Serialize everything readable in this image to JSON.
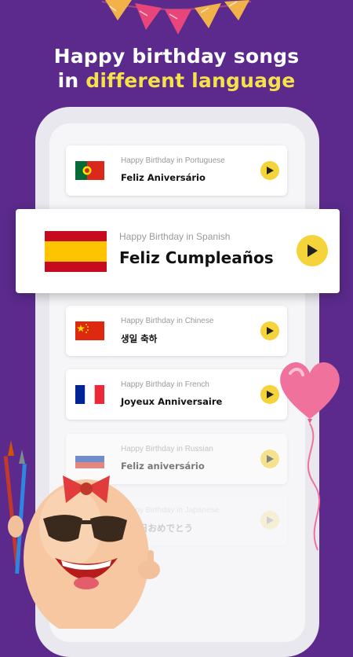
{
  "headline": {
    "line1": "Happy birthday songs",
    "line2_prefix": "in ",
    "line2_accent": "different language"
  },
  "colors": {
    "background": "#5b2a8c",
    "accent": "#f5e14a",
    "play": "#f5d33a"
  },
  "featured": {
    "subtitle": "Happy Birthday in Spanish",
    "title": "Feliz Cumpleaños",
    "flag_icon": "spain-flag-icon"
  },
  "songs": [
    {
      "subtitle": "Happy Birthday in Portuguese",
      "title": "Feliz Aniversário",
      "flag_icon": "portugal-flag-icon"
    },
    {
      "subtitle": "Happy Birthday in Chinese",
      "title": "생일 축하",
      "flag_icon": "china-flag-icon"
    },
    {
      "subtitle": "Happy Birthday in French",
      "title": "Joyeux Anniversaire",
      "flag_icon": "france-flag-icon"
    },
    {
      "subtitle": "Happy Birthday in Russian",
      "title": "Feliz aniversário",
      "flag_icon": "russia-flag-icon"
    },
    {
      "subtitle": "Happy Birthday in Japanese",
      "title": "誕生日おめでとう",
      "flag_icon": "japan-flag-icon"
    }
  ]
}
